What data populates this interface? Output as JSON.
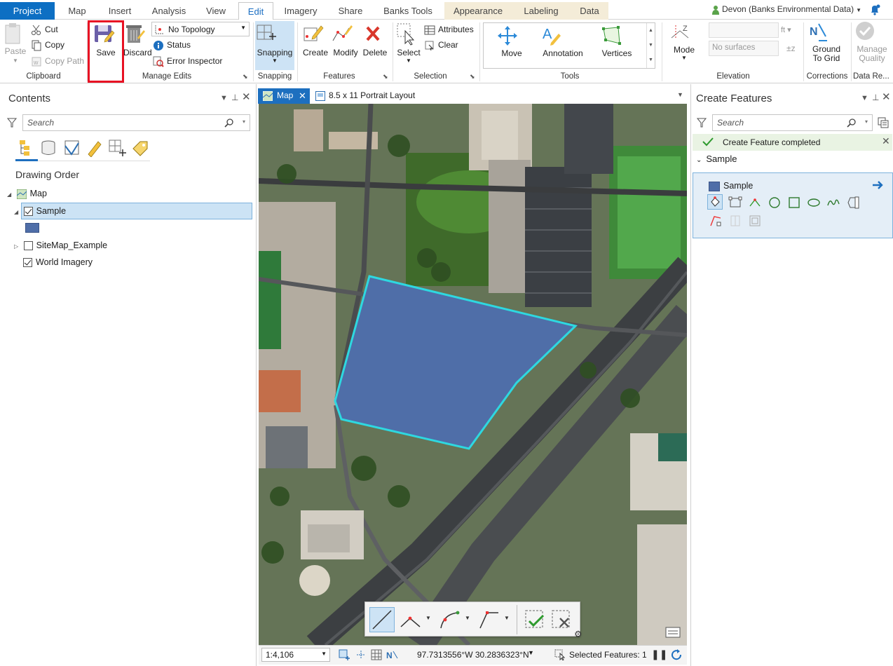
{
  "tabs": [
    {
      "label": "Project"
    },
    {
      "label": "Map"
    },
    {
      "label": "Insert"
    },
    {
      "label": "Analysis"
    },
    {
      "label": "View"
    },
    {
      "label": "Edit"
    },
    {
      "label": "Imagery"
    },
    {
      "label": "Share"
    },
    {
      "label": "Banks Tools"
    },
    {
      "label": "Appearance"
    },
    {
      "label": "Labeling"
    },
    {
      "label": "Data"
    }
  ],
  "user": "Devon (Banks Environmental Data)",
  "ribbon": {
    "clipboard": {
      "paste": "Paste",
      "cut": "Cut",
      "copy": "Copy",
      "copy_path": "Copy Path",
      "label": "Clipboard"
    },
    "manage_edits": {
      "save": "Save",
      "discard": "Discard",
      "topology": "No Topology",
      "status": "Status",
      "error_inspector": "Error Inspector",
      "label": "Manage Edits"
    },
    "snapping": {
      "snapping": "Snapping",
      "label": "Snapping"
    },
    "features": {
      "create": "Create",
      "modify": "Modify",
      "delete": "Delete",
      "label": "Features"
    },
    "selection": {
      "select": "Select",
      "attributes": "Attributes",
      "clear": "Clear",
      "label": "Selection"
    },
    "tools": {
      "move": "Move",
      "annotation": "Annotation",
      "vertices": "Vertices",
      "label": "Tools"
    },
    "elevation": {
      "mode": "Mode",
      "unit": "ft",
      "surface_placeholder": "No surfaces",
      "label": "Elevation"
    },
    "corrections": {
      "ground_to_grid": "Ground To Grid",
      "label": "Corrections"
    },
    "data_reviewer": {
      "manage_quality": "Manage Quality",
      "label": "Data Re..."
    }
  },
  "contents": {
    "title": "Contents",
    "search_placeholder": "Search",
    "heading": "Drawing Order",
    "layers": [
      {
        "name": "Map"
      },
      {
        "name": "Sample",
        "checked": true,
        "selected": true
      },
      {
        "name": "SiteMap_Example",
        "checked": false
      },
      {
        "name": "World Imagery",
        "checked": true
      }
    ],
    "sample_color": "#4f6ea8"
  },
  "view_tabs": [
    {
      "label": "Map"
    },
    {
      "label": "8.5 x 11 Portrait Layout"
    }
  ],
  "create_features": {
    "title": "Create Features",
    "search_placeholder": "Search",
    "message": "Create Feature completed",
    "group": "Sample",
    "template": "Sample"
  },
  "status": {
    "scale": "1:4,106",
    "coordinates": "97.7313556°W 30.2836323°N",
    "selected": "Selected Features: 1"
  },
  "colors": {
    "accent": "#0d6fc3",
    "highlight": "#e81123",
    "polygon_fill": "#4f6ea8",
    "polygon_outline": "#2ed8e0"
  }
}
